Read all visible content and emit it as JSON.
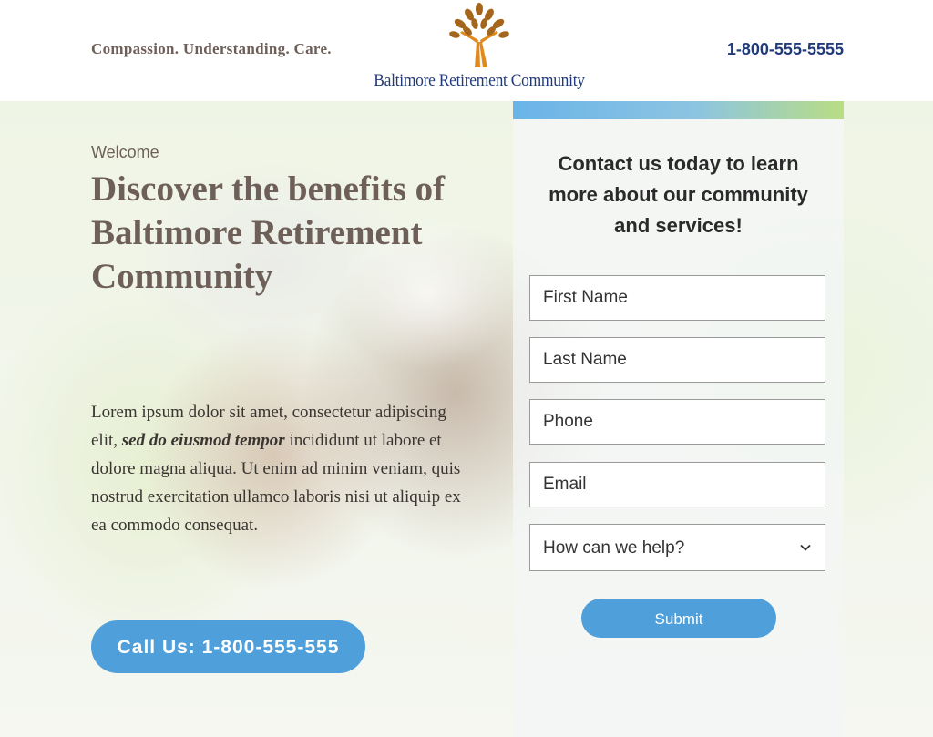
{
  "header": {
    "tagline": "Compassion. Understanding. Care.",
    "logo_text": "Baltimore Retirement Community",
    "phone": "1-800-555-5555",
    "logo_icon": "tree-icon",
    "colors": {
      "tagline": "#6e6058",
      "brand": "#213a7a",
      "tree": "#e08a1e"
    }
  },
  "hero": {
    "welcome": "Welcome",
    "headline": "Discover the benefits of Baltimore Retirement Community",
    "body_before": "Lorem ipsum dolor sit amet, consectetur adipiscing elit, ",
    "body_emphasis": "sed do eiusmod tempor",
    "body_after": " incididunt ut labore et dolore magna aliqua. Ut enim ad minim veniam, quis nostrud exercitation ullamco laboris nisi ut aliquip ex ea commodo consequat.",
    "call_button": "Call Us: 1-800-555-555",
    "colors": {
      "button": "#4f9fdb",
      "heading": "#6e6058"
    }
  },
  "form": {
    "title": "Contact us today to learn more about our community and services!",
    "first_name_placeholder": "First Name",
    "last_name_placeholder": "Last Name",
    "phone_placeholder": "Phone",
    "email_placeholder": "Email",
    "help_select": "How can we help?",
    "select_icon": "chevron-down-icon",
    "submit": "Submit",
    "colors": {
      "bar_start": "#6ab4e8",
      "bar_end": "#b9dd84",
      "submit": "#4f9fdb"
    }
  }
}
